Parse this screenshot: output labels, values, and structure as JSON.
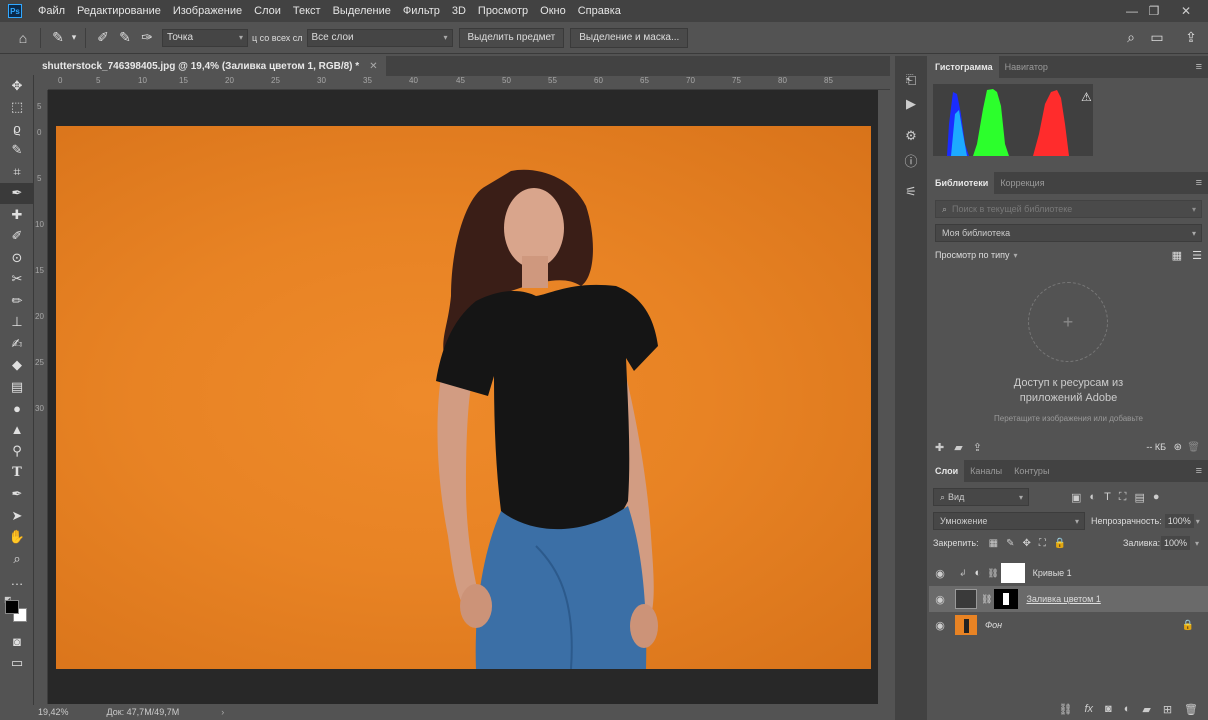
{
  "menubar": {
    "logo": "Ps",
    "items": [
      "Файл",
      "Редактирование",
      "Изображение",
      "Слои",
      "Текст",
      "Выделение",
      "Фильтр",
      "3D",
      "Просмотр",
      "Окно",
      "Справка"
    ]
  },
  "options": {
    "sample_size": "Точка",
    "sample_layers_label": "ц со всех сл",
    "sample_layers": "Все слои",
    "select_subject": "Выделить предмет",
    "select_mask": "Выделение и маска..."
  },
  "document": {
    "tab_title": "shutterstock_746398405.jpg @ 19,4% (Заливка цветом 1, RGB/8) *",
    "zoom": "19,42%",
    "doc_size": "Док: 47,7M/49,7M"
  },
  "ruler": {
    "h": [
      "0",
      "5",
      "10",
      "15",
      "20",
      "25",
      "30",
      "35",
      "40",
      "45",
      "50",
      "55",
      "60",
      "65",
      "70",
      "75",
      "80",
      "85"
    ],
    "v": [
      "5",
      "0",
      "5",
      "10",
      "15",
      "20",
      "25",
      "30"
    ]
  },
  "panels": {
    "histogram_tab": "Гистограмма",
    "navigator_tab": "Навигатор",
    "libraries_tab": "Библиотеки",
    "adjustments_tab": "Коррекция",
    "search_placeholder": "Поиск в текущей библиотеке",
    "library_name": "Моя библиотека",
    "view_by_type": "Просмотр по типу",
    "adobe_access": "Доступ к ресурсам из приложений Adobe",
    "drag_hint": "Перетащите изображения или добавьте",
    "kb": "-- КБ",
    "layers_tab": "Слои",
    "channels_tab": "Каналы",
    "paths_tab": "Контуры",
    "kind_filter": "Вид",
    "blend_mode": "Умножение",
    "opacity_label": "Непрозрачность:",
    "opacity_value": "100%",
    "lock_label": "Закрепить:",
    "fill_label": "Заливка:",
    "fill_value": "100%"
  },
  "layers": [
    {
      "name": "Кривые 1",
      "selected": false
    },
    {
      "name": "Заливка цветом 1",
      "selected": true
    },
    {
      "name": "Фон",
      "selected": false
    }
  ],
  "colors": {
    "accent": "#31a8ff",
    "canvas_orange": "#e88324",
    "panel_bg": "#535353",
    "selected_layer": "#6a6a6a"
  }
}
